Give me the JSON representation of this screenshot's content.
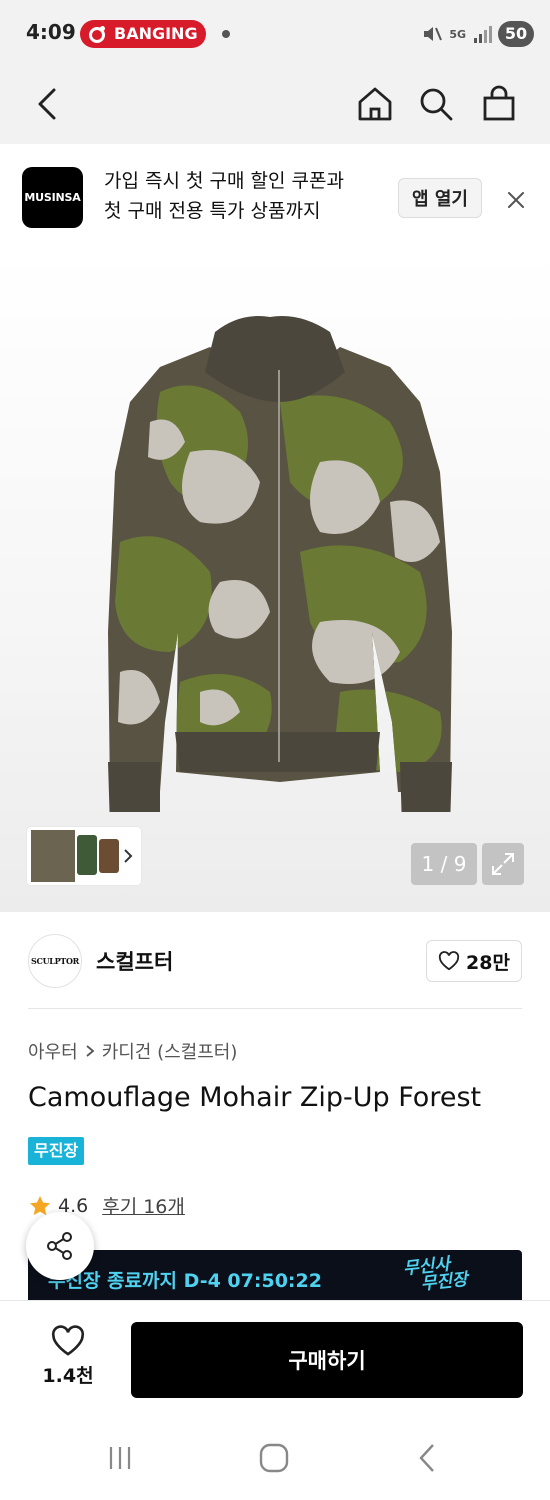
{
  "status_bar": {
    "time": "4:09",
    "notification": "BANGING",
    "network": "5G",
    "battery": "50"
  },
  "promo": {
    "logo": "MUSINSA",
    "line1": "가입 즉시 첫 구매 할인 쿠폰과",
    "line2": "첫 구매 전용 특가 상품까지",
    "open_label": "앱 열기"
  },
  "gallery": {
    "counter": "1 / 9"
  },
  "brand": {
    "logo": "SCULPTOR",
    "name": "스컬프터",
    "likes": "28만"
  },
  "breadcrumb": {
    "category": "아우터",
    "subcategory": "카디건 (스컬프터)"
  },
  "product": {
    "title": "Camouflage Mohair Zip-Up Forest",
    "tag": "무진장",
    "rating": "4.6",
    "reviews": "후기 16개"
  },
  "sale_banner": {
    "text": "무진장 종료까지 D-4 07:50:22",
    "logo_line1": "무신사",
    "logo_line2": "무진장"
  },
  "bottom": {
    "wish_count": "1.4천",
    "buy_label": "구매하기"
  },
  "colors": {
    "accent_cyan": "#18b3d6",
    "banner_bg": "#0b0f1a",
    "notification_red": "#d81b2a",
    "star": "#f5a623"
  }
}
